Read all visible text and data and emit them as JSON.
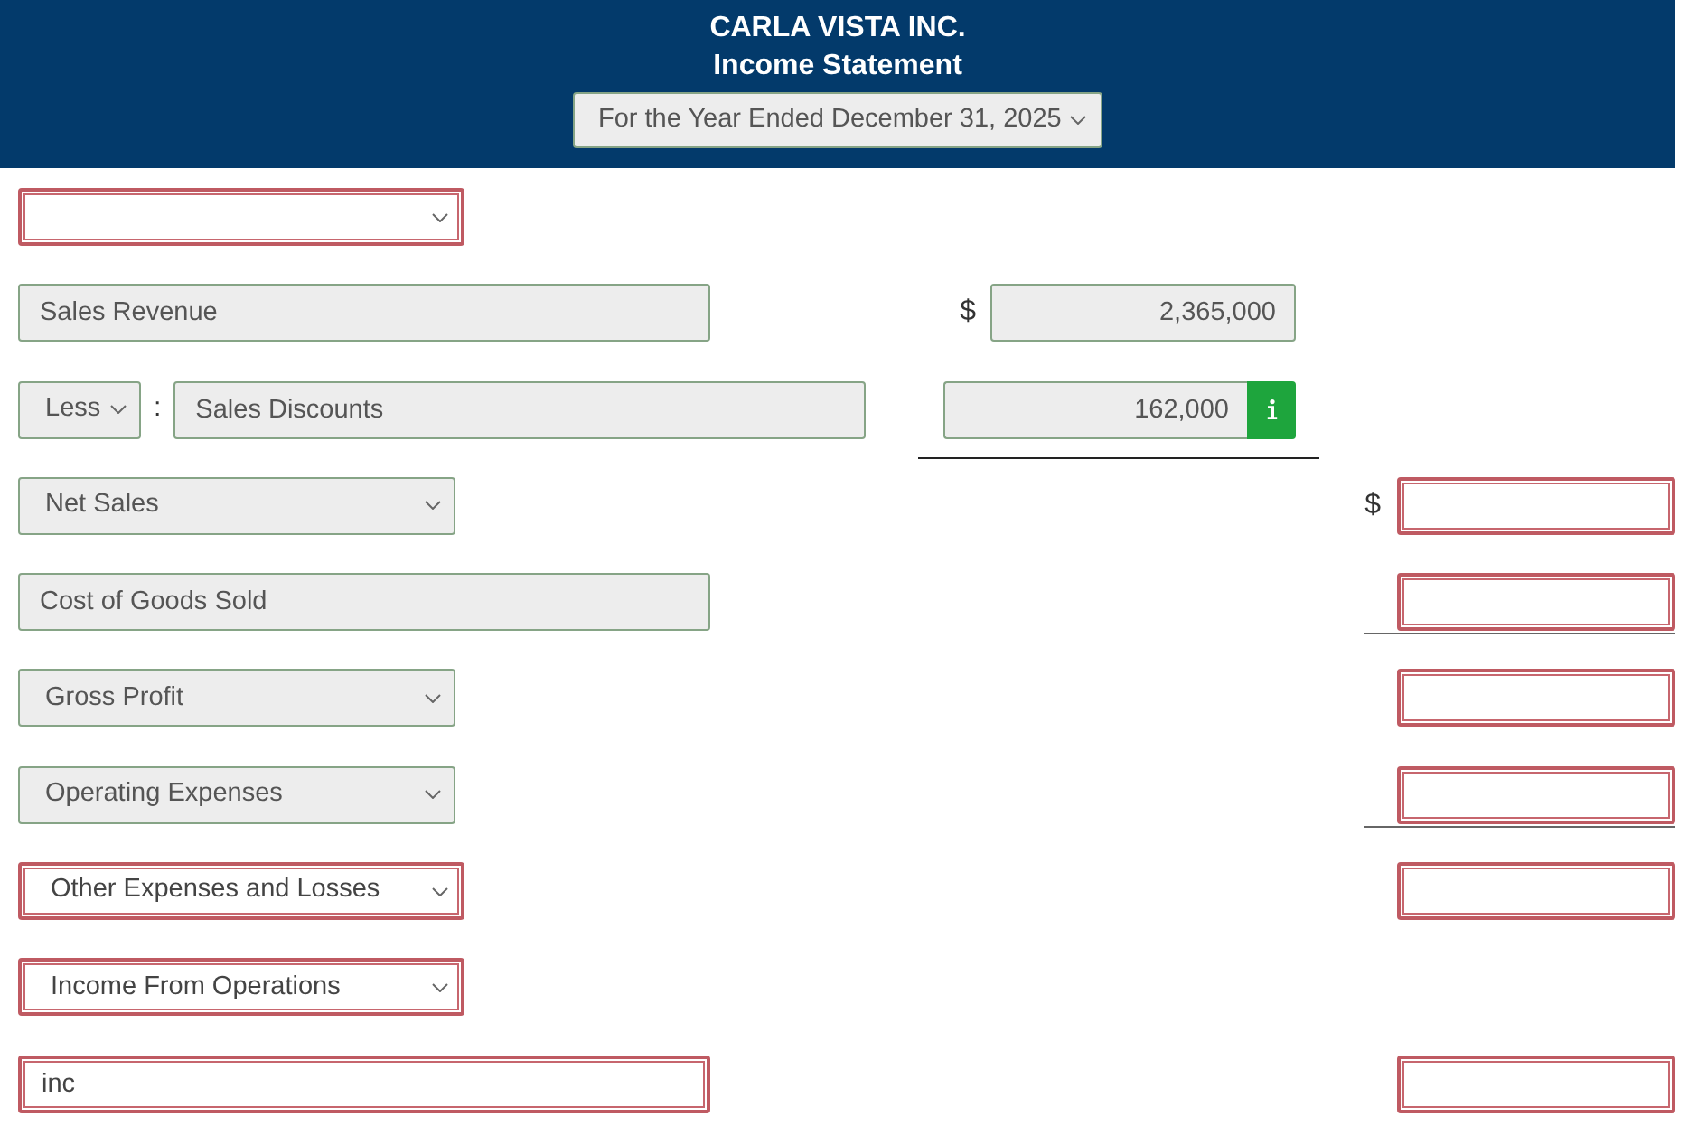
{
  "header": {
    "company": "CARLA VISTA INC.",
    "title": "Income Statement",
    "period": {
      "kind": "select",
      "value": "For the Year Ended December 31, 2025",
      "invalid": false
    }
  },
  "rows": [
    {
      "account": {
        "kind": "select",
        "invalid": true
      }
    },
    {
      "account": {
        "kind": "text",
        "value": "Sales Revenue",
        "invalid": false
      },
      "amount_1": {
        "currency": "$",
        "value": "2,365,000",
        "invalid": false
      }
    },
    {
      "prefix": {
        "kind": "select",
        "value": "Less",
        "invalid": false
      },
      "separator": ":",
      "account": {
        "kind": "text",
        "value": "Sales Discounts",
        "invalid": false
      },
      "amount_1": {
        "value": "162,000",
        "invalid": false,
        "info_button": true,
        "rule_below": true
      }
    },
    {
      "account": {
        "kind": "select",
        "value": "Net Sales",
        "invalid": false
      },
      "amount_2": {
        "currency": "$",
        "invalid": true
      }
    },
    {
      "account": {
        "kind": "text",
        "value": "Cost of Goods Sold",
        "invalid": false
      },
      "amount_2": {
        "invalid": true,
        "rule_below": true
      }
    },
    {
      "account": {
        "kind": "select",
        "value": "Gross Profit",
        "invalid": false
      },
      "amount_2": {
        "invalid": true
      }
    },
    {
      "account": {
        "kind": "select",
        "value": "Operating Expenses",
        "invalid": false
      },
      "amount_2": {
        "invalid": true,
        "rule_below": true
      }
    },
    {
      "account": {
        "kind": "select",
        "value": "Other Expenses and Losses",
        "invalid": true
      },
      "amount_2": {
        "invalid": true
      }
    },
    {
      "account": {
        "kind": "select",
        "value": "Income From Operations",
        "invalid": true
      }
    },
    {
      "account": {
        "kind": "text",
        "value": "inc",
        "invalid": true
      },
      "amount_2": {
        "invalid": true
      }
    }
  ]
}
